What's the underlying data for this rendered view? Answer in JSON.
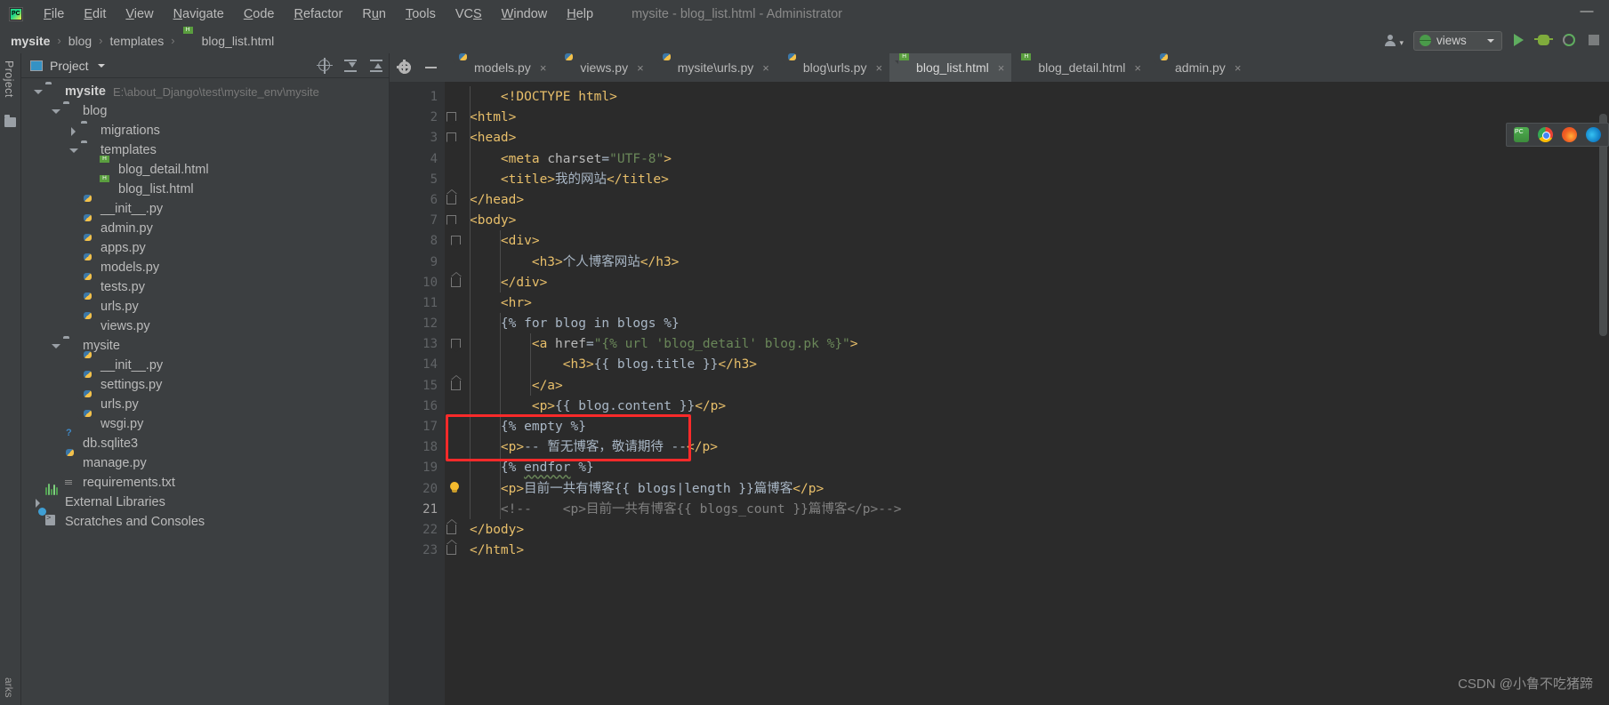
{
  "window": {
    "title": "mysite - blog_list.html - Administrator",
    "logo_text": "PC",
    "minimize_label": "—"
  },
  "menubar": {
    "items": [
      {
        "label": "File",
        "mnemonic": "F"
      },
      {
        "label": "Edit",
        "mnemonic": "E"
      },
      {
        "label": "View",
        "mnemonic": "V"
      },
      {
        "label": "Navigate",
        "mnemonic": "N"
      },
      {
        "label": "Code",
        "mnemonic": "C"
      },
      {
        "label": "Refactor",
        "mnemonic": "R"
      },
      {
        "label": "Run",
        "mnemonic": "u"
      },
      {
        "label": "Tools",
        "mnemonic": "T"
      },
      {
        "label": "VCS",
        "mnemonic": "S"
      },
      {
        "label": "Window",
        "mnemonic": "W"
      },
      {
        "label": "Help",
        "mnemonic": "H"
      }
    ]
  },
  "breadcrumb": {
    "items": [
      "mysite",
      "blog",
      "templates"
    ],
    "file": "blog_list.html",
    "separator": "›"
  },
  "toolbar_right": {
    "run_config": "views",
    "run_tooltip": "Run",
    "debug_tooltip": "Debug",
    "coverage_tooltip": "Run with Coverage",
    "stop_tooltip": "Stop"
  },
  "left_strip": {
    "project_label": "Project",
    "bottom_label": "arks"
  },
  "project_panel": {
    "title": "Project",
    "icons": [
      "locate-icon",
      "expand-all-icon",
      "collapse-all-icon"
    ],
    "tree": [
      {
        "label": "mysite",
        "path": "E:\\about_Django\\test\\mysite_env\\mysite",
        "icon": "folder-icon",
        "indent": 0,
        "arrow": "down",
        "bold": true
      },
      {
        "label": "blog",
        "icon": "module-folder-icon",
        "indent": 1,
        "arrow": "down"
      },
      {
        "label": "migrations",
        "icon": "module-folder-icon",
        "indent": 2,
        "arrow": "right"
      },
      {
        "label": "templates",
        "icon": "folder-icon",
        "indent": 2,
        "arrow": "down"
      },
      {
        "label": "blog_detail.html",
        "icon": "html-file-icon",
        "indent": 3,
        "arrow": "none"
      },
      {
        "label": "blog_list.html",
        "icon": "html-file-icon",
        "indent": 3,
        "arrow": "none"
      },
      {
        "label": "__init__.py",
        "icon": "python-file-icon",
        "indent": 2,
        "arrow": "none"
      },
      {
        "label": "admin.py",
        "icon": "python-file-icon",
        "indent": 2,
        "arrow": "none"
      },
      {
        "label": "apps.py",
        "icon": "python-file-icon",
        "indent": 2,
        "arrow": "none"
      },
      {
        "label": "models.py",
        "icon": "python-file-icon",
        "indent": 2,
        "arrow": "none"
      },
      {
        "label": "tests.py",
        "icon": "python-file-icon",
        "indent": 2,
        "arrow": "none"
      },
      {
        "label": "urls.py",
        "icon": "python-file-icon",
        "indent": 2,
        "arrow": "none"
      },
      {
        "label": "views.py",
        "icon": "python-file-icon",
        "indent": 2,
        "arrow": "none"
      },
      {
        "label": "mysite",
        "icon": "module-folder-icon",
        "indent": 1,
        "arrow": "down"
      },
      {
        "label": "__init__.py",
        "icon": "python-file-icon",
        "indent": 2,
        "arrow": "none"
      },
      {
        "label": "settings.py",
        "icon": "python-file-icon",
        "indent": 2,
        "arrow": "none"
      },
      {
        "label": "urls.py",
        "icon": "python-file-icon",
        "indent": 2,
        "arrow": "none"
      },
      {
        "label": "wsgi.py",
        "icon": "python-file-icon",
        "indent": 2,
        "arrow": "none"
      },
      {
        "label": "db.sqlite3",
        "icon": "db-file-icon",
        "indent": 1,
        "arrow": "none"
      },
      {
        "label": "manage.py",
        "icon": "python-file-icon",
        "indent": 1,
        "arrow": "none"
      },
      {
        "label": "requirements.txt",
        "icon": "text-file-icon",
        "indent": 1,
        "arrow": "none"
      },
      {
        "label": "External Libraries",
        "icon": "library-icon",
        "indent": 0,
        "arrow": "right"
      },
      {
        "label": "Scratches and Consoles",
        "icon": "scratches-icon",
        "indent": 0,
        "arrow": "none"
      }
    ]
  },
  "editor": {
    "tabs": [
      {
        "label": "models.py",
        "icon": "python-file-icon",
        "active": false
      },
      {
        "label": "views.py",
        "icon": "python-file-icon",
        "active": false
      },
      {
        "label": "mysite\\urls.py",
        "icon": "python-file-icon",
        "active": false
      },
      {
        "label": "blog\\urls.py",
        "icon": "python-file-icon",
        "active": false
      },
      {
        "label": "blog_list.html",
        "icon": "html-file-icon",
        "active": true
      },
      {
        "label": "blog_detail.html",
        "icon": "html-file-icon",
        "active": false
      },
      {
        "label": "admin.py",
        "icon": "python-file-icon",
        "active": false
      }
    ],
    "tab_close_glyph": "×",
    "current_line": 21,
    "lines": [
      {
        "n": 1,
        "fold": "none",
        "marker": "none",
        "tokens": [
          {
            "t": "    ",
            "c": "t-plain"
          },
          {
            "t": "<!DOCTYPE html>",
            "c": "t-tag"
          }
        ]
      },
      {
        "n": 2,
        "fold": "open",
        "marker": "none",
        "tokens": [
          {
            "t": "<html>",
            "c": "t-tag"
          }
        ]
      },
      {
        "n": 3,
        "fold": "open",
        "marker": "none",
        "tokens": [
          {
            "t": "<head>",
            "c": "t-tag"
          }
        ]
      },
      {
        "n": 4,
        "fold": "none",
        "marker": "none",
        "tokens": [
          {
            "t": "    ",
            "c": "t-plain"
          },
          {
            "t": "<meta ",
            "c": "t-tag"
          },
          {
            "t": "charset",
            "c": "t-attr"
          },
          {
            "t": "=",
            "c": "t-plain"
          },
          {
            "t": "\"UTF-8\"",
            "c": "t-str"
          },
          {
            "t": ">",
            "c": "t-tag"
          }
        ]
      },
      {
        "n": 5,
        "fold": "none",
        "marker": "none",
        "tokens": [
          {
            "t": "    ",
            "c": "t-plain"
          },
          {
            "t": "<title>",
            "c": "t-tag"
          },
          {
            "t": "我的网站",
            "c": "t-txt"
          },
          {
            "t": "</title>",
            "c": "t-tag"
          }
        ]
      },
      {
        "n": 6,
        "fold": "close",
        "marker": "none",
        "tokens": [
          {
            "t": "</head>",
            "c": "t-tag"
          }
        ]
      },
      {
        "n": 7,
        "fold": "open",
        "marker": "none",
        "tokens": [
          {
            "t": "<body>",
            "c": "t-tag"
          }
        ]
      },
      {
        "n": 8,
        "fold": "open2",
        "marker": "none",
        "tokens": [
          {
            "t": "    ",
            "c": "t-plain"
          },
          {
            "t": "<div>",
            "c": "t-tag"
          }
        ]
      },
      {
        "n": 9,
        "fold": "none",
        "marker": "none",
        "tokens": [
          {
            "t": "        ",
            "c": "t-plain"
          },
          {
            "t": "<h3>",
            "c": "t-tag"
          },
          {
            "t": "个人博客网站",
            "c": "t-txt"
          },
          {
            "t": "</h3>",
            "c": "t-tag"
          }
        ]
      },
      {
        "n": 10,
        "fold": "close2",
        "marker": "none",
        "tokens": [
          {
            "t": "    ",
            "c": "t-plain"
          },
          {
            "t": "</div>",
            "c": "t-tag"
          }
        ]
      },
      {
        "n": 11,
        "fold": "none",
        "marker": "none",
        "tokens": [
          {
            "t": "    ",
            "c": "t-plain"
          },
          {
            "t": "<hr>",
            "c": "t-tag"
          }
        ]
      },
      {
        "n": 12,
        "fold": "none",
        "marker": "none",
        "tokens": [
          {
            "t": "    ",
            "c": "t-plain"
          },
          {
            "t": "{% for blog in blogs %}",
            "c": "t-dj"
          }
        ]
      },
      {
        "n": 13,
        "fold": "open2",
        "marker": "none",
        "tokens": [
          {
            "t": "        ",
            "c": "t-plain"
          },
          {
            "t": "<a ",
            "c": "t-tag"
          },
          {
            "t": "href",
            "c": "t-attr"
          },
          {
            "t": "=",
            "c": "t-plain"
          },
          {
            "t": "\"{% url 'blog_detail' blog.pk %}\"",
            "c": "t-str"
          },
          {
            "t": ">",
            "c": "t-tag"
          }
        ]
      },
      {
        "n": 14,
        "fold": "none",
        "marker": "none",
        "tokens": [
          {
            "t": "            ",
            "c": "t-plain"
          },
          {
            "t": "<h3>",
            "c": "t-tag"
          },
          {
            "t": "{{ blog.title }}",
            "c": "t-var"
          },
          {
            "t": "</h3>",
            "c": "t-tag"
          }
        ]
      },
      {
        "n": 15,
        "fold": "close2",
        "marker": "none",
        "tokens": [
          {
            "t": "        ",
            "c": "t-plain"
          },
          {
            "t": "</a>",
            "c": "t-tag"
          }
        ]
      },
      {
        "n": 16,
        "fold": "none",
        "marker": "none",
        "tokens": [
          {
            "t": "        ",
            "c": "t-plain"
          },
          {
            "t": "<p>",
            "c": "t-tag"
          },
          {
            "t": "{{ blog.content }}",
            "c": "t-var"
          },
          {
            "t": "</p>",
            "c": "t-tag"
          }
        ]
      },
      {
        "n": 17,
        "fold": "none",
        "marker": "none",
        "tokens": [
          {
            "t": "    ",
            "c": "t-plain"
          },
          {
            "t": "{% empty %}",
            "c": "t-dj"
          }
        ]
      },
      {
        "n": 18,
        "fold": "none",
        "marker": "none",
        "tokens": [
          {
            "t": "    ",
            "c": "t-plain"
          },
          {
            "t": "<p>",
            "c": "t-tag"
          },
          {
            "t": "-- 暂无博客，敬请期待 --",
            "c": "t-txt"
          },
          {
            "t": "</p>",
            "c": "t-tag"
          }
        ]
      },
      {
        "n": 19,
        "fold": "none",
        "marker": "none",
        "tokens": [
          {
            "t": "    ",
            "c": "t-plain"
          },
          {
            "t": "{% ",
            "c": "t-dj"
          },
          {
            "t": "endfor",
            "c": "t-dj squiggle"
          },
          {
            "t": " %}",
            "c": "t-dj"
          }
        ]
      },
      {
        "n": 20,
        "fold": "none",
        "marker": "bulb",
        "tokens": [
          {
            "t": "    ",
            "c": "t-plain"
          },
          {
            "t": "<p>",
            "c": "t-tag"
          },
          {
            "t": "目前一共有博客",
            "c": "t-txt"
          },
          {
            "t": "{{ blogs|length }}",
            "c": "t-var"
          },
          {
            "t": "篇博客",
            "c": "t-txt"
          },
          {
            "t": "</p>",
            "c": "t-tag"
          }
        ]
      },
      {
        "n": 21,
        "fold": "none",
        "marker": "none",
        "current": true,
        "tokens": [
          {
            "t": "    <!--    <p>目前一共有博客{{ blogs_count }}篇博客</p>-->",
            "c": "t-cmt"
          }
        ]
      },
      {
        "n": 22,
        "fold": "close",
        "marker": "none",
        "tokens": [
          {
            "t": "</body>",
            "c": "t-tag"
          }
        ]
      },
      {
        "n": 23,
        "fold": "close",
        "marker": "none",
        "tokens": [
          {
            "t": "</html>",
            "c": "t-tag"
          }
        ]
      }
    ],
    "annotation": {
      "label": "red-highlight-box",
      "color": "#fb2a2a",
      "covers_lines": [
        17,
        18
      ]
    }
  },
  "browser_strip": {
    "icons": [
      "ie-browser-icon",
      "chrome-browser-icon",
      "firefox-browser-icon",
      "edge-browser-icon"
    ]
  },
  "watermark": {
    "text": "CSDN @小鲁不吃猪蹄"
  }
}
